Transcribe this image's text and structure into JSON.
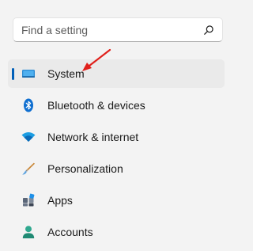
{
  "search": {
    "placeholder": "Find a setting",
    "icon": "search-icon"
  },
  "nav": {
    "items": [
      {
        "label": "System",
        "icon": "monitor-icon",
        "selected": true
      },
      {
        "label": "Bluetooth & devices",
        "icon": "bluetooth-icon",
        "selected": false
      },
      {
        "label": "Network & internet",
        "icon": "wifi-icon",
        "selected": false
      },
      {
        "label": "Personalization",
        "icon": "brush-icon",
        "selected": false
      },
      {
        "label": "Apps",
        "icon": "apps-icon",
        "selected": false
      },
      {
        "label": "Accounts",
        "icon": "person-icon",
        "selected": false
      }
    ]
  },
  "annotation": {
    "arrow_color": "#e0201b",
    "points_to": "System"
  },
  "colors": {
    "accent": "#005fb8",
    "background": "#f3f3f3",
    "selected_bg": "#eaeaea"
  }
}
